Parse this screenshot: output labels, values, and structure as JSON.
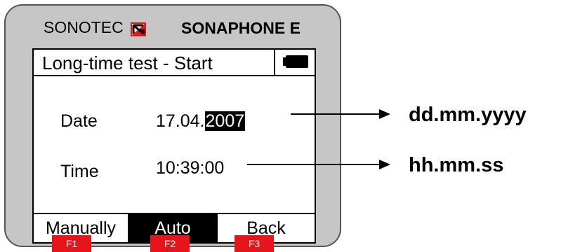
{
  "device": {
    "brand_left": "SONOTEC",
    "brand_right": "SONAPHONE E",
    "logo_icon": "sonotec-logo-icon"
  },
  "screen": {
    "title": "Long-time test - Start",
    "battery_icon": "battery-icon",
    "fields": [
      {
        "label": "Date",
        "value_plain": "17.04.",
        "value_selected": "2007"
      },
      {
        "label": "Time",
        "value_plain": "10:39:00",
        "value_selected": ""
      }
    ],
    "softkeys": [
      {
        "label": "Manually",
        "active": false
      },
      {
        "label": "Auto",
        "active": true
      },
      {
        "label": "Back",
        "active": false
      }
    ]
  },
  "function_keys": [
    "F1",
    "F2",
    "F3"
  ],
  "annotations": {
    "date_format": "dd.mm.yyyy",
    "time_format": "hh.mm.ss"
  },
  "colors": {
    "device_body": "#c6c6c6",
    "function_key": "#e8141c",
    "highlight": "#000000"
  }
}
